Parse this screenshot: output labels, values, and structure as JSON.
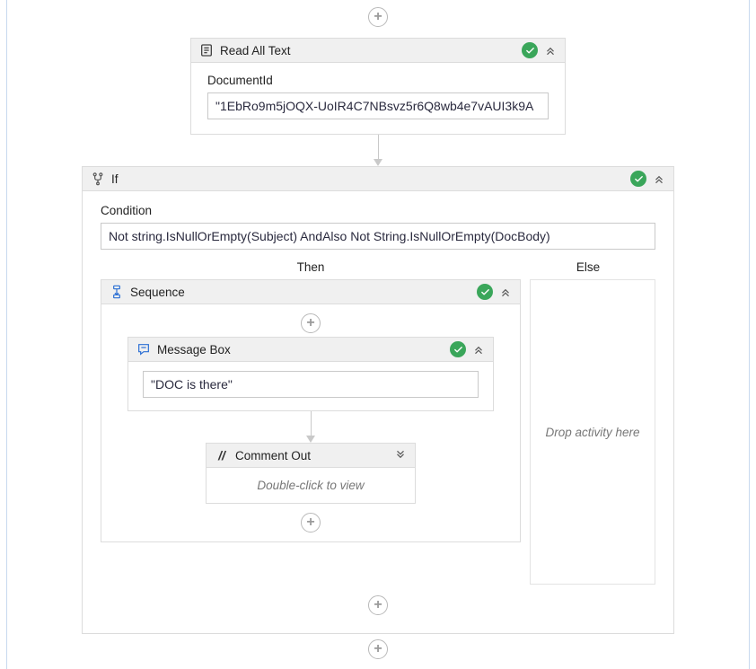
{
  "read_all_text": {
    "header": "Read All Text",
    "field_label": "DocumentId",
    "field_value": "\"1EbRo9m5jOQX-UoIR4C7NBsvz5r6Q8wb4e7vAUI3k9A"
  },
  "if_activity": {
    "header": "If",
    "condition_label": "Condition",
    "condition_value": "Not string.IsNullOrEmpty(Subject) AndAlso Not String.IsNullOrEmpty(DocBody)",
    "then_label": "Then",
    "else_label": "Else",
    "else_placeholder": "Drop activity here"
  },
  "sequence": {
    "header": "Sequence"
  },
  "message_box": {
    "header": "Message Box",
    "value": "\"DOC is there\""
  },
  "comment_out": {
    "header": "Comment Out",
    "body_hint": "Double-click to view"
  }
}
